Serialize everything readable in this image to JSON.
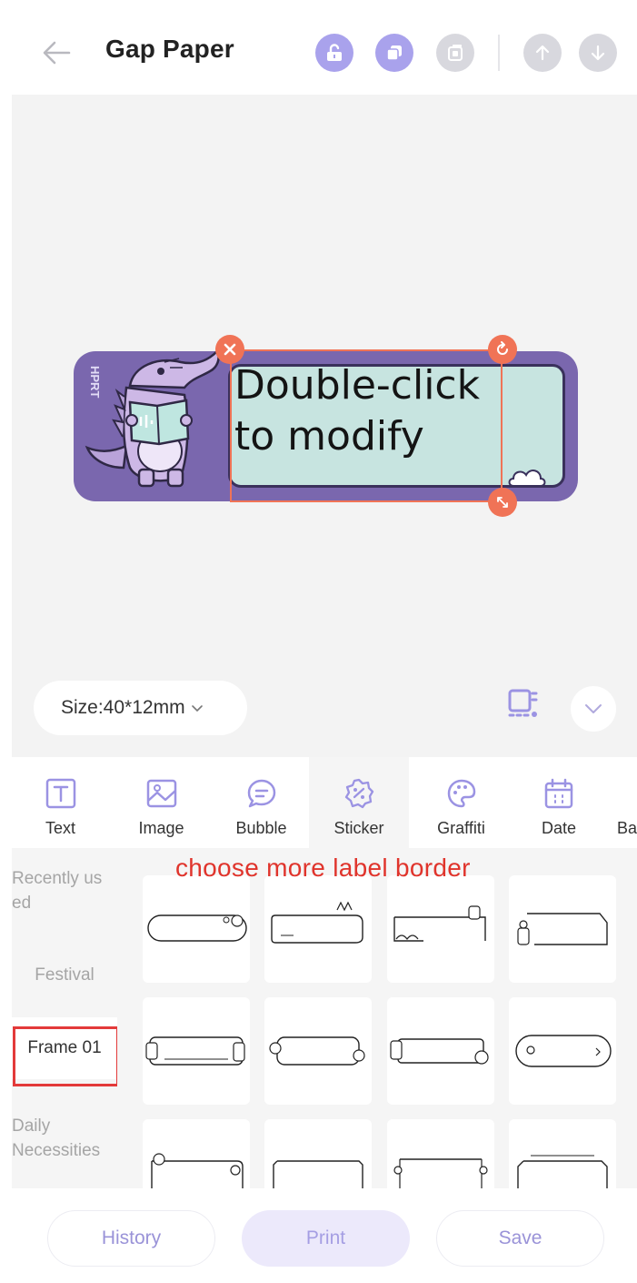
{
  "header": {
    "title": "Gap Paper",
    "buttons": [
      {
        "name": "unlock-icon",
        "state": "active"
      },
      {
        "name": "copy-icon",
        "state": "active"
      },
      {
        "name": "paste-icon",
        "state": "inactive"
      },
      {
        "name": "layer-up-icon",
        "state": "inactive"
      },
      {
        "name": "layer-down-icon",
        "state": "inactive"
      }
    ]
  },
  "canvas": {
    "label_brand": "HPRT",
    "text_line1": "Double-click",
    "text_line2": "to modify",
    "size_label": "Size:40*12mm",
    "size_chevron": "∨"
  },
  "tools": [
    {
      "label": "Text",
      "icon": "text-icon"
    },
    {
      "label": "Image",
      "icon": "image-icon"
    },
    {
      "label": "Bubble",
      "icon": "bubble-icon"
    },
    {
      "label": "Sticker",
      "icon": "sticker-icon",
      "active": true
    },
    {
      "label": "Graffiti",
      "icon": "palette-icon"
    },
    {
      "label": "Date",
      "icon": "calendar-icon"
    },
    {
      "label": "Ba",
      "icon": "barcode-icon"
    }
  ],
  "categories": [
    {
      "label": "Recently used",
      "line1": "Recently us",
      "line2": "ed"
    },
    {
      "label": "Festival"
    },
    {
      "label": "Frame 01",
      "selected": true
    },
    {
      "label": "Daily Necessities",
      "line1": "Daily",
      "line2": "Necessities"
    }
  ],
  "annotation": "choose more label border",
  "bottom": {
    "history": "History",
    "print": "Print",
    "save": "Save"
  },
  "colors": {
    "accent": "#a9a2ec",
    "selection": "#f07356",
    "annotation_red": "#e0342c",
    "label_purple": "#7a67ae",
    "label_mint": "#c7e4e0"
  }
}
